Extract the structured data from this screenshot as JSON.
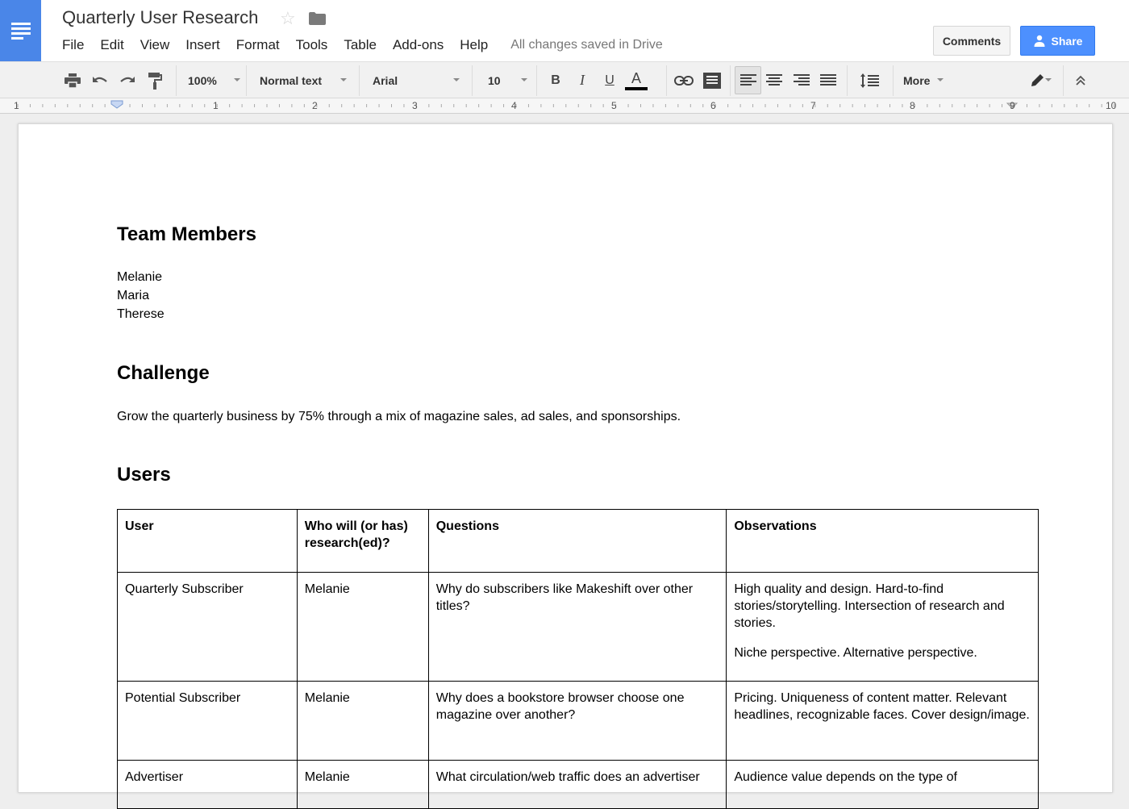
{
  "app": {
    "doc_title": "Quarterly User Research",
    "save_status": "All changes saved in Drive",
    "menu": [
      "File",
      "Edit",
      "View",
      "Insert",
      "Format",
      "Tools",
      "Table",
      "Add-ons",
      "Help"
    ],
    "comments_label": "Comments",
    "share_label": "Share",
    "accent_color": "#4a86e8"
  },
  "toolbar": {
    "zoom": "100%",
    "style": "Normal text",
    "font": "Arial",
    "size": "10",
    "bold": "B",
    "italic": "I",
    "underline": "U",
    "text_color": "A",
    "more": "More",
    "icons": [
      "print-icon",
      "undo-icon",
      "redo-icon",
      "paint-format-icon",
      "link-icon",
      "comment-icon",
      "align-left-icon",
      "align-center-icon",
      "align-right-icon",
      "align-justify-icon",
      "line-spacing-icon",
      "edit-mode-icon",
      "collapse-icon"
    ]
  },
  "ruler": {
    "labels": [
      "1",
      "1",
      "2",
      "3",
      "4",
      "5",
      "6",
      "7",
      "8",
      "9",
      "10"
    ]
  },
  "document": {
    "team_heading": "Team Members",
    "team_members": [
      "Melanie",
      "Maria",
      "Therese"
    ],
    "challenge_heading": "Challenge",
    "challenge_text": "Grow the quarterly business by 75% through a mix of magazine sales, ad sales, and sponsorships.",
    "users_heading": "Users",
    "table": {
      "headers": [
        "User",
        "Who will (or has) research(ed)?",
        "Questions",
        "Observations"
      ],
      "rows": [
        {
          "user": "Quarterly Subscriber",
          "researcher": "Melanie",
          "question": "Why do subscribers like Makeshift over other titles?",
          "observation_1": "High quality and design. Hard-to-find stories/storytelling. Intersection of research and stories.",
          "observation_2": "Niche perspective. Alternative perspective."
        },
        {
          "user": "Potential Subscriber",
          "researcher": "Melanie",
          "question": "Why does a bookstore browser choose one magazine over another?",
          "observation_1": "Pricing. Uniqueness of content matter. Relevant headlines, recognizable faces. Cover design/image.",
          "observation_2": ""
        },
        {
          "user": "Advertiser",
          "researcher": "Melanie",
          "question": "What circulation/web traffic does an advertiser",
          "observation_1": "Audience value depends on the type of",
          "observation_2": ""
        }
      ]
    }
  }
}
